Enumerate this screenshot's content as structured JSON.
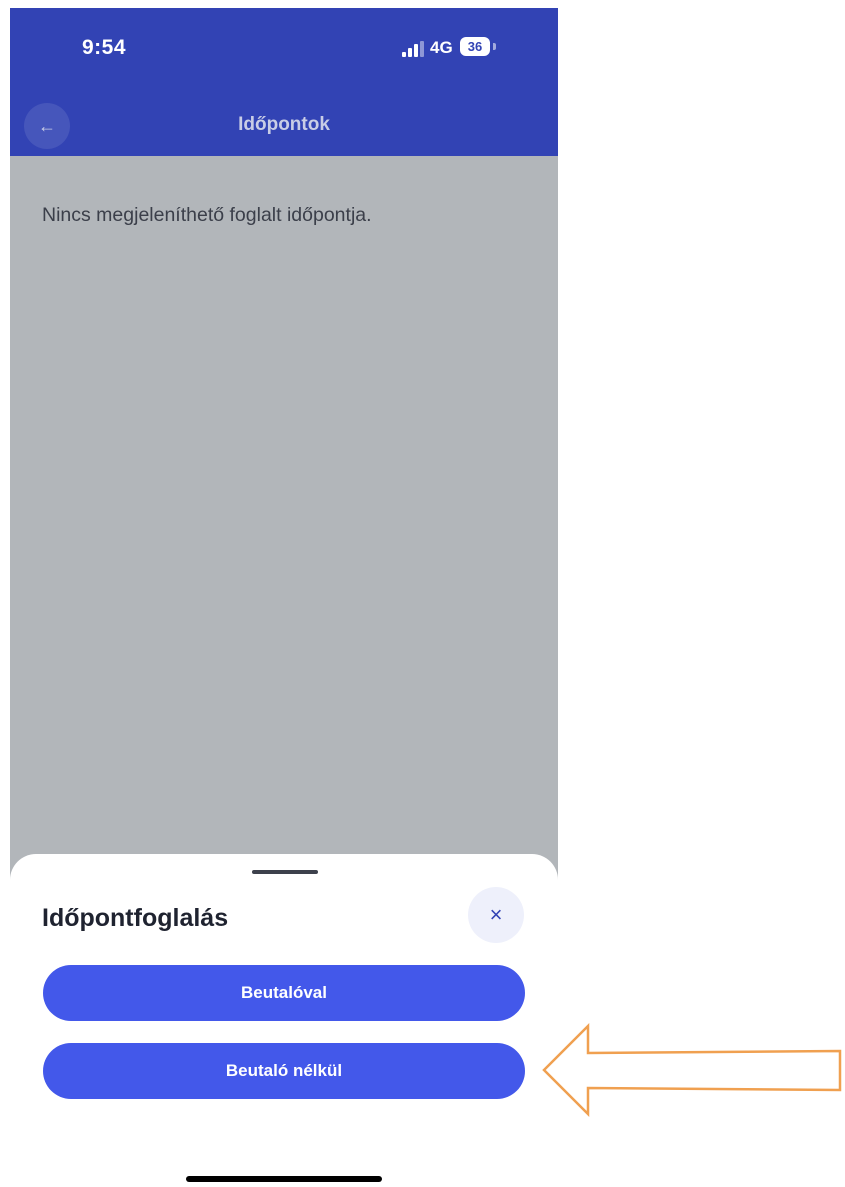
{
  "status_bar": {
    "time": "9:54",
    "network": "4G",
    "battery": "36"
  },
  "header": {
    "back_icon": "←",
    "title": "Időpontok"
  },
  "main": {
    "empty_message": "Nincs megjeleníthető foglalt időpontja."
  },
  "sheet": {
    "title": "Időpontfoglalás",
    "close_icon": "×",
    "buttons": [
      {
        "label": "Beutalóval"
      },
      {
        "label": "Beutaló nélkül"
      }
    ]
  },
  "colors": {
    "header_bg": "#3243b4",
    "button_bg": "#4358ea",
    "overlay_bg": "#b2b6ba",
    "arrow": "#f0a050"
  },
  "icons": {
    "back": "arrow-left-icon",
    "close": "close-icon",
    "signal": "signal-icon",
    "battery": "battery-icon",
    "annotation": "orange-arrow-icon"
  }
}
